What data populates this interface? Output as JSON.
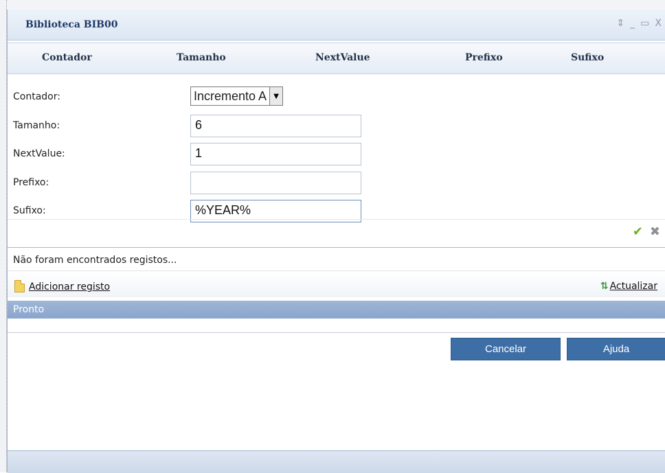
{
  "window": {
    "title": "Biblioteca BIB00",
    "controls": {
      "restore": "⇕",
      "minimize": "_",
      "maximize": "▭",
      "close": "X"
    }
  },
  "grid": {
    "columns": [
      "Contador",
      "Tamanho",
      "NextValue",
      "Prefixo",
      "Sufixo"
    ]
  },
  "form": {
    "contador": {
      "label": "Contador:",
      "value": "Incremento A"
    },
    "tamanho": {
      "label": "Tamanho:",
      "value": "6"
    },
    "nextvalue": {
      "label": "NextValue:",
      "value": "1"
    },
    "prefixo": {
      "label": "Prefixo:",
      "value": ""
    },
    "sufixo": {
      "label": "Sufixo:",
      "value": "%YEAR%"
    }
  },
  "message": "Não foram encontrados registos...",
  "toolbar": {
    "add_label": "Adicionar registo",
    "refresh_label": "Actualizar"
  },
  "status": "Pronto",
  "buttons": {
    "cancel": "Cancelar",
    "help": "Ajuda"
  },
  "colors": {
    "accent": "#3d6ea6",
    "status_bar": "#8aa6cd",
    "ok_icon": "#6ab024"
  }
}
